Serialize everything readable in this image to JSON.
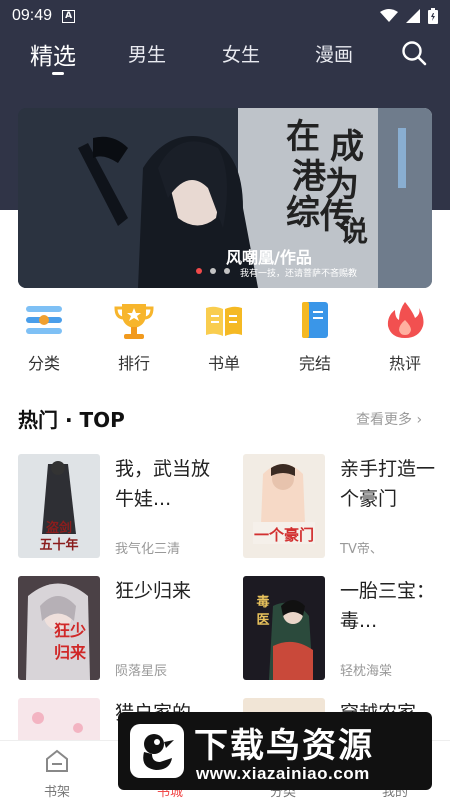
{
  "status_bar": {
    "time": "09:49",
    "notification_badge": "A"
  },
  "top_tabs": [
    {
      "label": "精选",
      "active": true
    },
    {
      "label": "男生",
      "active": false
    },
    {
      "label": "女生",
      "active": false
    },
    {
      "label": "漫画",
      "active": false
    }
  ],
  "banner": {
    "title_lines": [
      "在",
      "港",
      "综",
      "成",
      "为",
      "传",
      "说"
    ],
    "author_credit": "风嘲凰/作品",
    "tagline": "我有一技，还请菩萨不吝赐教"
  },
  "categories": [
    {
      "label": "分类",
      "icon": "list-icon",
      "color": "#4a9eea"
    },
    {
      "label": "排行",
      "icon": "trophy-icon",
      "color": "#f5a623"
    },
    {
      "label": "书单",
      "icon": "book-open-icon",
      "color": "#f5b923"
    },
    {
      "label": "完结",
      "icon": "bookmark-book-icon",
      "color": "#3a96e8"
    },
    {
      "label": "热评",
      "icon": "flame-icon",
      "color": "#f25050"
    }
  ],
  "section": {
    "title": "热门 · TOP",
    "more_label": "查看更多"
  },
  "books": [
    {
      "title": "我，武当放牛娃...",
      "author": "我气化三清",
      "cover_text": "盗剑五十年"
    },
    {
      "title": "亲手打造一个豪门",
      "author": "TV帝、",
      "cover_text": "一个豪门"
    },
    {
      "title": "狂少归来",
      "author": "陨落星辰",
      "cover_text": "狂少归来"
    },
    {
      "title": "一胎三宝：毒...",
      "author": "轻枕海棠",
      "cover_text": "毒医狂妃"
    },
    {
      "title": "猎户家的",
      "author": "",
      "cover_text": ""
    },
    {
      "title": "穿越农家",
      "author": "",
      "cover_text": ""
    }
  ],
  "bottom_nav": [
    {
      "label": "书架",
      "icon": "bookshelf-icon"
    },
    {
      "label": "书城",
      "icon": "bookstore-icon"
    },
    {
      "label": "分类",
      "icon": "category-icon"
    },
    {
      "label": "我的",
      "icon": "profile-icon"
    }
  ],
  "watermark": {
    "name": "下载鸟资源",
    "url": "www.xiazainiao.com"
  },
  "colors": {
    "header": "#303447",
    "accent_red": "#f14a4a"
  }
}
